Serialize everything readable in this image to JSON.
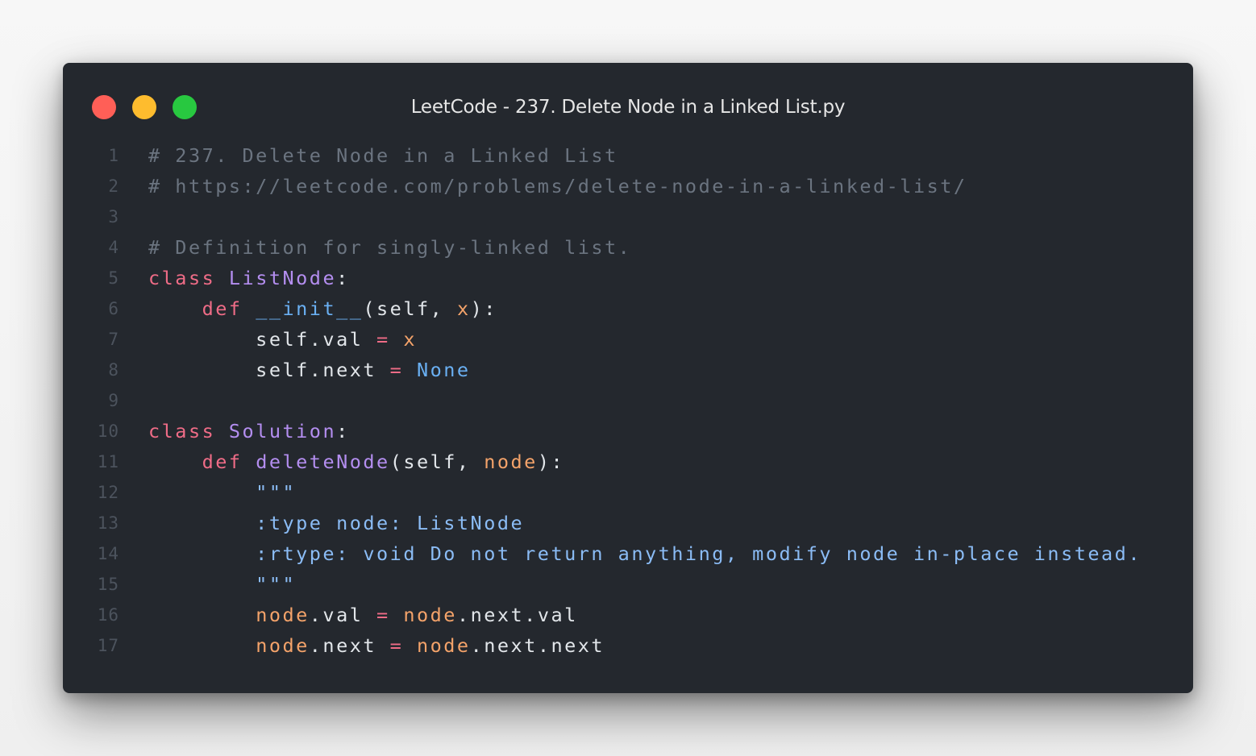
{
  "window": {
    "title": "LeetCode - 237. Delete Node in a Linked List.py",
    "controls": [
      {
        "name": "close",
        "color": "#ff5f57"
      },
      {
        "name": "minimize",
        "color": "#febc2e"
      },
      {
        "name": "zoom",
        "color": "#28c840"
      }
    ]
  },
  "colors": {
    "background": "#24282e",
    "comment": "#6b7480",
    "keyword": "#ef6c87",
    "class_name": "#b48ef0",
    "function_name": "#b48ef0",
    "parameter": "#f4a36a",
    "builtin_constant": "#6ab0f3",
    "operator": "#ef6c87",
    "docstring": "#8bbcf5",
    "plain": "#e2e6ea",
    "line_number": "#4c535d"
  },
  "code": {
    "language": "python",
    "lines": [
      {
        "number": "1",
        "tokens": [
          {
            "text": "# 237. Delete Node in a Linked List",
            "type": "comment"
          }
        ]
      },
      {
        "number": "2",
        "tokens": [
          {
            "text": "# https://leetcode.com/problems/delete-node-in-a-linked-list/",
            "type": "comment"
          }
        ]
      },
      {
        "number": "3",
        "tokens": []
      },
      {
        "number": "4",
        "tokens": [
          {
            "text": "# Definition for singly-linked list.",
            "type": "comment"
          }
        ]
      },
      {
        "number": "5",
        "tokens": [
          {
            "text": "class",
            "type": "keyword"
          },
          {
            "text": " ",
            "type": "plain"
          },
          {
            "text": "ListNode",
            "type": "class_name"
          },
          {
            "text": ":",
            "type": "plain"
          }
        ]
      },
      {
        "number": "6",
        "tokens": [
          {
            "text": "    ",
            "type": "plain"
          },
          {
            "text": "def",
            "type": "keyword"
          },
          {
            "text": " ",
            "type": "plain"
          },
          {
            "text": "__init__",
            "type": "builtin_constant"
          },
          {
            "text": "(self, ",
            "type": "plain"
          },
          {
            "text": "x",
            "type": "parameter"
          },
          {
            "text": "):",
            "type": "plain"
          }
        ]
      },
      {
        "number": "7",
        "tokens": [
          {
            "text": "        self.val ",
            "type": "plain"
          },
          {
            "text": "=",
            "type": "operator"
          },
          {
            "text": " ",
            "type": "plain"
          },
          {
            "text": "x",
            "type": "parameter"
          }
        ]
      },
      {
        "number": "8",
        "tokens": [
          {
            "text": "        self.next ",
            "type": "plain"
          },
          {
            "text": "=",
            "type": "operator"
          },
          {
            "text": " ",
            "type": "plain"
          },
          {
            "text": "None",
            "type": "builtin_constant"
          }
        ]
      },
      {
        "number": "9",
        "tokens": []
      },
      {
        "number": "10",
        "tokens": [
          {
            "text": "class",
            "type": "keyword"
          },
          {
            "text": " ",
            "type": "plain"
          },
          {
            "text": "Solution",
            "type": "class_name"
          },
          {
            "text": ":",
            "type": "plain"
          }
        ]
      },
      {
        "number": "11",
        "tokens": [
          {
            "text": "    ",
            "type": "plain"
          },
          {
            "text": "def",
            "type": "keyword"
          },
          {
            "text": " ",
            "type": "plain"
          },
          {
            "text": "deleteNode",
            "type": "function_name"
          },
          {
            "text": "(self, ",
            "type": "plain"
          },
          {
            "text": "node",
            "type": "parameter"
          },
          {
            "text": "):",
            "type": "plain"
          }
        ]
      },
      {
        "number": "12",
        "tokens": [
          {
            "text": "        \"\"\"",
            "type": "docstring"
          }
        ]
      },
      {
        "number": "13",
        "tokens": [
          {
            "text": "        :type node: ListNode",
            "type": "docstring"
          }
        ]
      },
      {
        "number": "14",
        "tokens": [
          {
            "text": "        :rtype: void Do not return anything, modify node in-place instead.",
            "type": "docstring"
          }
        ]
      },
      {
        "number": "15",
        "tokens": [
          {
            "text": "        \"\"\"",
            "type": "docstring"
          }
        ]
      },
      {
        "number": "16",
        "tokens": [
          {
            "text": "        ",
            "type": "plain"
          },
          {
            "text": "node",
            "type": "parameter"
          },
          {
            "text": ".val ",
            "type": "plain"
          },
          {
            "text": "=",
            "type": "operator"
          },
          {
            "text": " ",
            "type": "plain"
          },
          {
            "text": "node",
            "type": "parameter"
          },
          {
            "text": ".next.val",
            "type": "plain"
          }
        ]
      },
      {
        "number": "17",
        "tokens": [
          {
            "text": "        ",
            "type": "plain"
          },
          {
            "text": "node",
            "type": "parameter"
          },
          {
            "text": ".next ",
            "type": "plain"
          },
          {
            "text": "=",
            "type": "operator"
          },
          {
            "text": " ",
            "type": "plain"
          },
          {
            "text": "node",
            "type": "parameter"
          },
          {
            "text": ".next.next",
            "type": "plain"
          }
        ]
      }
    ]
  }
}
